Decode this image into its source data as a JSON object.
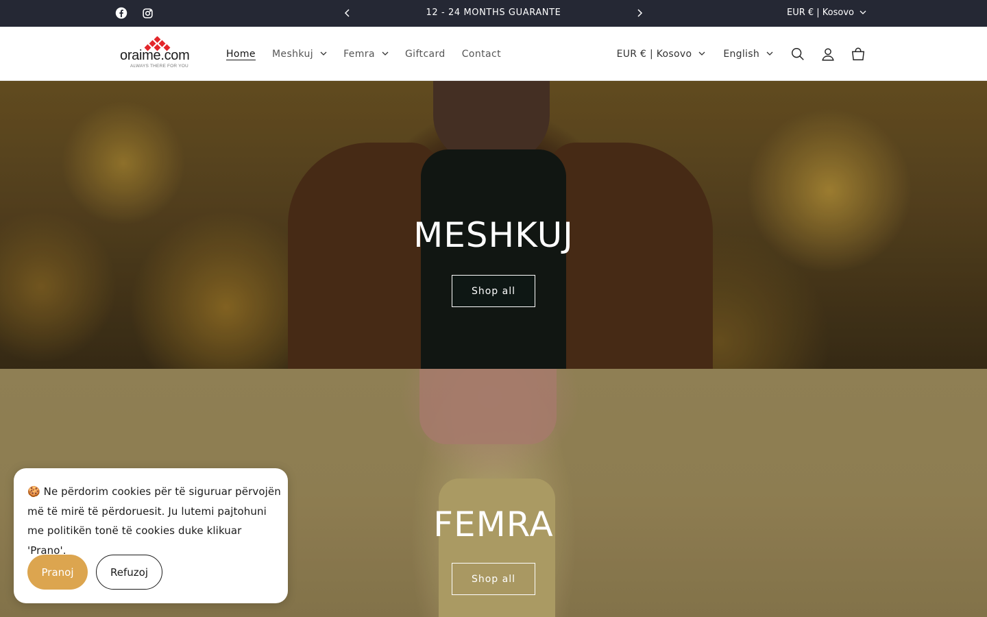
{
  "announcement": {
    "message": "12 - 24 MONTHS GUARANTE",
    "location": "EUR € | Kosovo"
  },
  "icons": {
    "facebook": "facebook-icon",
    "instagram": "instagram-icon",
    "prev": "chevron-left-icon",
    "next": "chevron-right-icon",
    "search": "search-icon",
    "account": "account-icon",
    "cart": "cart-icon"
  },
  "header": {
    "logo_text": "oraime.com",
    "logo_tagline": "ALWAYS THERE FOR YOU",
    "nav": [
      {
        "label": "Home"
      },
      {
        "label": "Meshkuj"
      },
      {
        "label": "Femra"
      },
      {
        "label": "Giftcard"
      },
      {
        "label": "Contact"
      }
    ],
    "currency": "EUR € | Kosovo",
    "language": "English"
  },
  "banners": {
    "men": {
      "title": "MESHKUJ",
      "button": "Shop all"
    },
    "women": {
      "title": "FEMRA",
      "button": "Shop all"
    }
  },
  "cookie": {
    "message": "🍪 Ne përdorim cookies për të siguruar përvojën më të mirë të përdoruesit. Ju lutemi pajtohuni me politikën tonë të cookies duke klikuar 'Prano'.",
    "accept": "Pranoj",
    "decline": "Refuzoj"
  },
  "colors": {
    "announcement_bg": "#252834",
    "accept_button": "#dca54f",
    "logo_red": "#e3262b"
  }
}
